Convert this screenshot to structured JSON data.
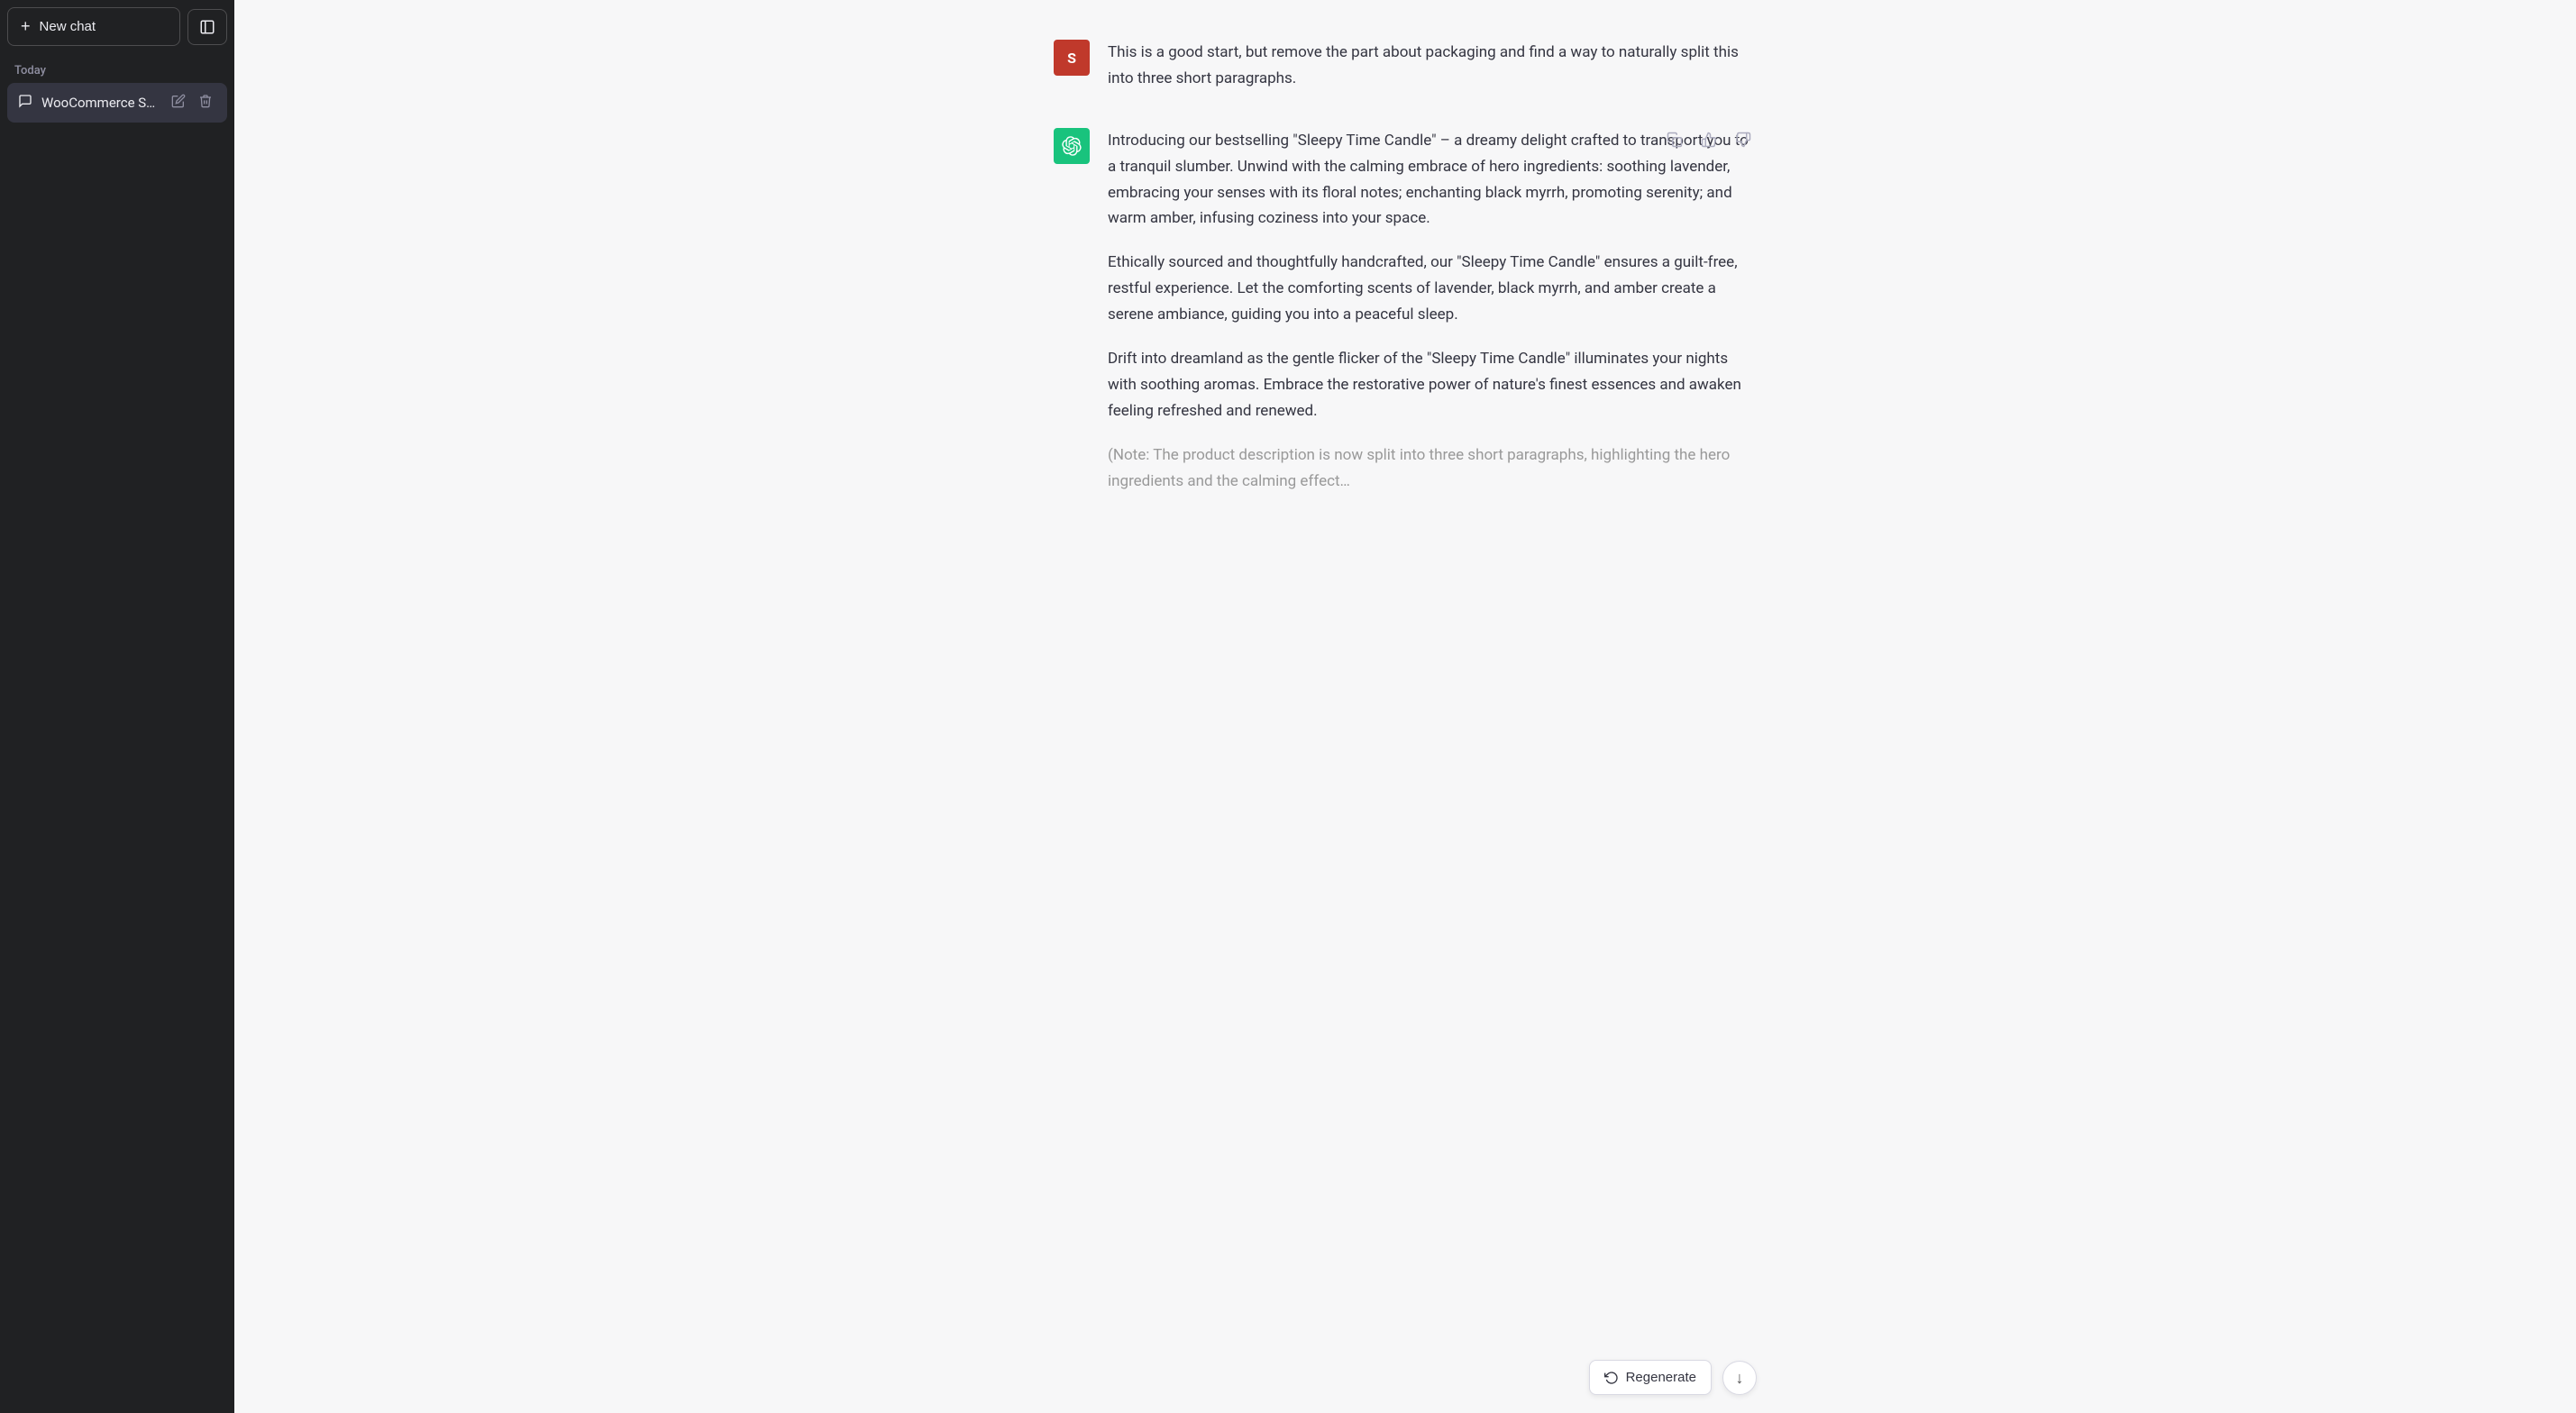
{
  "sidebar": {
    "new_chat_label": "New chat",
    "toggle_icon": "⊟",
    "section_today": "Today",
    "items": [
      {
        "id": "woocommerce-store",
        "label": "WooCommerce Store",
        "icon": "💬",
        "active": true,
        "actions": [
          {
            "id": "edit",
            "icon": "✏️",
            "label": "Edit"
          },
          {
            "id": "delete",
            "icon": "🗑️",
            "label": "Delete"
          }
        ]
      }
    ]
  },
  "chat": {
    "messages": [
      {
        "id": "user-1",
        "role": "user",
        "avatar_letter": "S",
        "text": "This is a good start, but remove the part about packaging and find a way to naturally split this into three short paragraphs."
      },
      {
        "id": "assistant-1",
        "role": "assistant",
        "paragraphs": [
          "Introducing our bestselling \"Sleepy Time Candle\" – a dreamy delight crafted to transport you to a tranquil slumber. Unwind with the calming embrace of hero ingredients: soothing lavender, embracing your senses with its floral notes; enchanting black myrrh, promoting serenity; and warm amber, infusing coziness into your space.",
          "Ethically sourced and thoughtfully handcrafted, our \"Sleepy Time Candle\" ensures a guilt-free, restful experience. Let the comforting scents of lavender, black myrrh, and amber create a serene ambiance, guiding you into a peaceful sleep.",
          "Drift into dreamland as the gentle flicker of the \"Sleepy Time Candle\" illuminates your nights with soothing aromas. Embrace the restorative power of nature's finest essences and awaken feeling refreshed and renewed.",
          "(Note: The product description is now split into three short paragraphs, highlighting the hero ingredients and the calming effect…"
        ],
        "actions": [
          "copy",
          "thumbup",
          "thumbdown"
        ]
      }
    ],
    "regenerate_label": "Regenerate",
    "scroll_down_icon": "↓"
  },
  "icons": {
    "plus": "+",
    "sidebar_toggle": "▣",
    "chat_bubble": "🗨",
    "edit": "✎",
    "delete": "🗑",
    "copy": "⧉",
    "thumbup": "👍",
    "thumbdown": "👎",
    "regenerate": "↺",
    "scroll_down": "↓"
  },
  "colors": {
    "sidebar_bg": "#202123",
    "user_avatar_bg": "#c0392b",
    "assistant_avatar_bg": "#19c37d",
    "active_item_bg": "#343541",
    "text_primary": "#343541",
    "text_muted": "#8e8ea0"
  }
}
